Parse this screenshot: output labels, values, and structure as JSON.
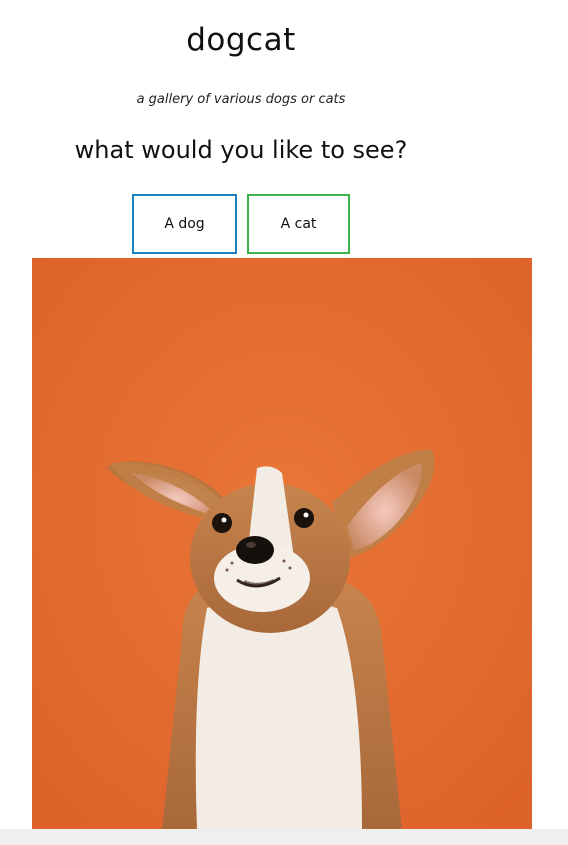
{
  "header": {
    "title": "dogcat",
    "tagline": "a gallery of various dogs or cats",
    "question": "what would you like to see?"
  },
  "buttons": {
    "dog_label": "A dog",
    "cat_label": "A cat"
  },
  "colors": {
    "dog_button_border": "#1f82c0",
    "cat_button_border": "#3cb44b",
    "photo_background": "#e46a2e"
  },
  "image": {
    "subject": "corgi-puppy-photo"
  }
}
